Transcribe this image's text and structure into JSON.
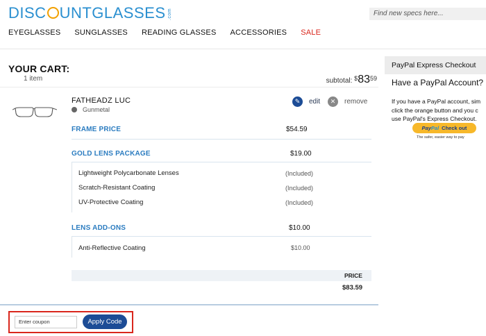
{
  "header": {
    "logo_pre": "DISC",
    "logo_post": "UNTGLASSES",
    "logo_suffix": ".com",
    "search_placeholder": "Find new specs here..."
  },
  "nav": [
    "EYEGLASSES",
    "SUNGLASSES",
    "READING GLASSES",
    "ACCESSORIES",
    "SALE"
  ],
  "cart": {
    "title": "YOUR CART:",
    "count": "1 item",
    "subtotal_label": "subtotal:",
    "subtotal_currency": "$",
    "subtotal_whole": "83",
    "subtotal_cents": "59"
  },
  "product": {
    "name": "FATHEADZ LUC",
    "color": "Gunmetal",
    "edit_label": "edit",
    "remove_label": "remove",
    "frame_label": "FRAME PRICE",
    "frame_price": "$54.59",
    "lens_label": "GOLD LENS PACKAGE",
    "lens_price": "$19.00",
    "lens_items": [
      {
        "name": "Lightweight Polycarbonate Lenses",
        "value": "(Included)"
      },
      {
        "name": "Scratch-Resistant Coating",
        "value": "(Included)"
      },
      {
        "name": "UV-Protective Coating",
        "value": "(Included)"
      }
    ],
    "addons_label": "LENS ADD-ONS",
    "addons_price": "$10.00",
    "addon_items": [
      {
        "name": "Anti-Reflective Coating",
        "value": "$10.00"
      }
    ],
    "price_header": "PRICE",
    "price_total": "$83.59"
  },
  "coupon": {
    "placeholder": "Enter coupon",
    "apply_label": "Apply Code"
  },
  "sidebar": {
    "header": "PayPal Express Checkout",
    "title": "Have a PayPal Account?",
    "body_lines": [
      "If you have a PayPal account, sim",
      "click the orange button and you c",
      "use PayPal's Express Checkout."
    ],
    "paypal_pay": "Pay",
    "paypal_pal": "Pal",
    "paypal_checkout": "Check out",
    "paypal_tagline": "The safer, easier way to pay"
  },
  "colors": {
    "brand_blue": "#2a8fd0",
    "accent_orange": "#f2a000",
    "button_navy": "#1c4c96",
    "sale_red": "#d9261c",
    "section_blue": "#2b7cc0"
  }
}
